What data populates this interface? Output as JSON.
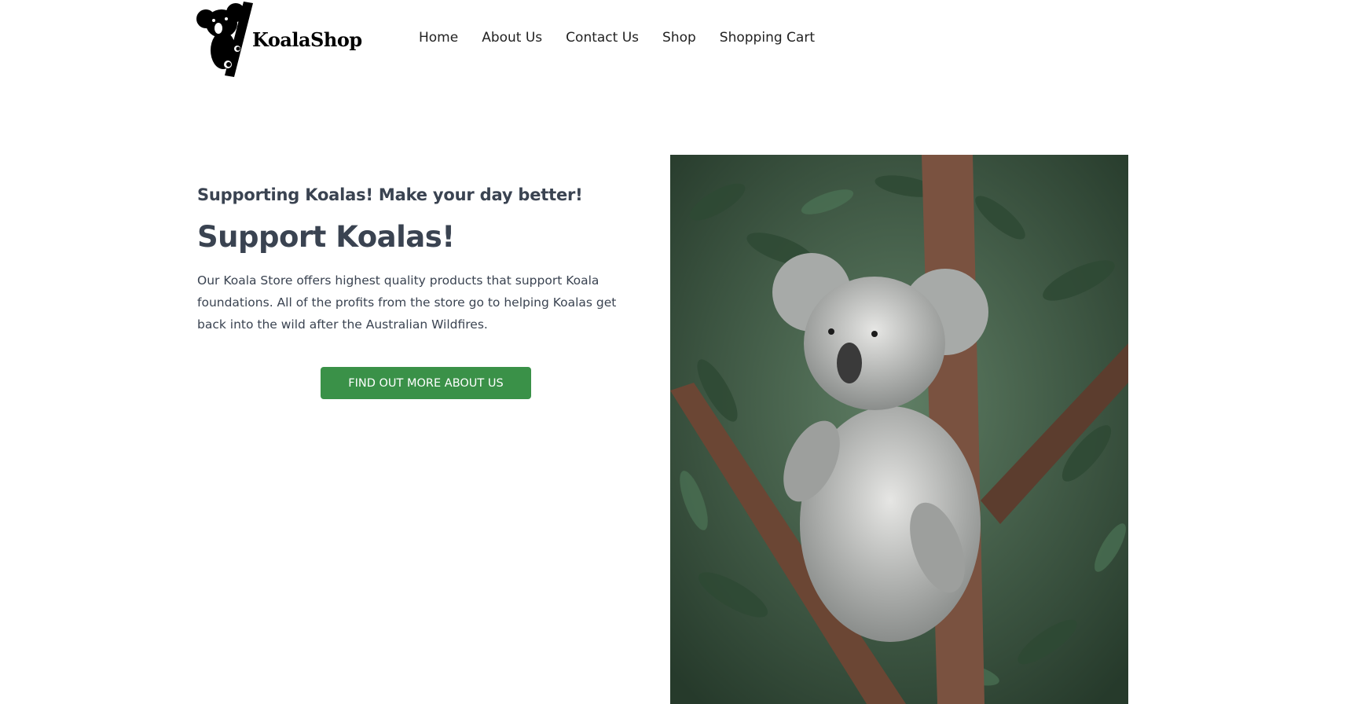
{
  "brand": {
    "name": "KoalaShop"
  },
  "nav": {
    "items": [
      {
        "label": "Home"
      },
      {
        "label": "About Us"
      },
      {
        "label": "Contact Us"
      },
      {
        "label": "Shop"
      },
      {
        "label": "Shopping Cart"
      }
    ]
  },
  "hero": {
    "tagline": "Supporting Koalas! Make your day better!",
    "headline": "Support Koalas!",
    "description": "Our Koala Store offers highest quality products that support Koala foundations. All of the profits from the store go to helping Koalas get back into the wild after the Australian Wildfires.",
    "cta_label": "FIND OUT MORE ABOUT US"
  },
  "colors": {
    "accent": "#3a9148",
    "text": "#3a4351",
    "foliage": "#3e5f45"
  },
  "icons": {
    "logo": "koala-on-branch-icon",
    "photo": "koala-in-tree-photo"
  }
}
